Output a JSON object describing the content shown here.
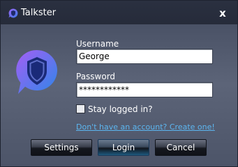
{
  "window": {
    "title": "Talkster",
    "close_glyph": "x",
    "app_icon": "shield-chat-icon"
  },
  "form": {
    "username_label": "Username",
    "username_value": "George",
    "password_label": "Password",
    "password_value": "************",
    "stay_logged_in_label": "Stay logged in?",
    "stay_logged_in_checked": false,
    "signup_link": "Don't have an account? Create one!"
  },
  "buttons": {
    "settings": "Settings",
    "login": "Login",
    "cancel": "Cancel"
  },
  "colors": {
    "brand_purple": "#7b5ff0",
    "brand_blue": "#2f7de0",
    "link": "#5cb6f0"
  }
}
